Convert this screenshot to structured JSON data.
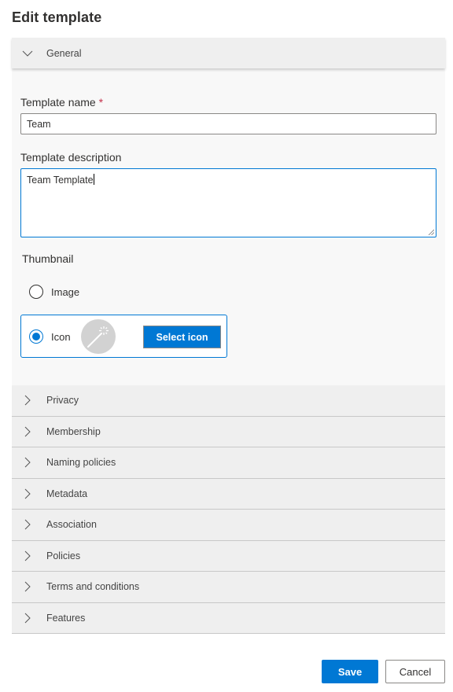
{
  "page": {
    "title": "Edit template"
  },
  "general": {
    "label": "General",
    "expanded": true,
    "template_name": {
      "label": "Template name",
      "required_marker": "*",
      "value": "Team"
    },
    "template_description": {
      "label": "Template description",
      "value": "Team Template"
    },
    "thumbnail": {
      "label": "Thumbnail",
      "options": [
        {
          "label": "Image",
          "selected": false
        },
        {
          "label": "Icon",
          "selected": true
        }
      ],
      "icon_preview": "magic-wand-icon",
      "select_icon_label": "Select icon"
    }
  },
  "sections": [
    {
      "label": "Privacy",
      "icon": "chevron-right-icon"
    },
    {
      "label": "Membership",
      "icon": "chevron-right-icon"
    },
    {
      "label": "Naming policies",
      "icon": "chevron-right-icon"
    },
    {
      "label": "Metadata",
      "icon": "chevron-right-icon"
    },
    {
      "label": "Association",
      "icon": "chevron-right-icon"
    },
    {
      "label": "Policies",
      "icon": "chevron-right-icon"
    },
    {
      "label": "Terms and conditions",
      "icon": "chevron-right-icon"
    },
    {
      "label": "Features",
      "icon": "chevron-right-icon"
    }
  ],
  "footer": {
    "save_label": "Save",
    "cancel_label": "Cancel"
  },
  "colors": {
    "accent": "#0078d4",
    "required": "#c4314b",
    "header_bg": "#efefef",
    "content_bg": "#f8f8f8"
  }
}
